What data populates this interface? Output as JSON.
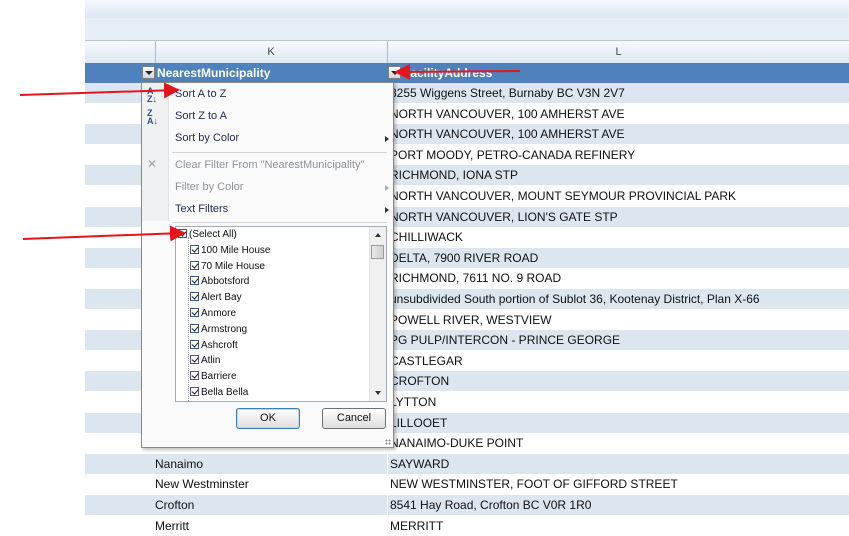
{
  "columns": {
    "k": "K",
    "l": "L"
  },
  "header": {
    "k_label": "NearestMunicipality",
    "l_label": "FacilityAddress"
  },
  "filter_menu": {
    "sort_az": "Sort A to Z",
    "sort_za": "Sort Z to A",
    "sort_by_color": "Sort by Color",
    "clear_filter": "Clear Filter From \"NearestMunicipality\"",
    "filter_by_color": "Filter by Color",
    "text_filters": "Text Filters",
    "list": [
      "(Select All)",
      "100 Mile House",
      "70 Mile House",
      "Abbotsford",
      "Alert Bay",
      "Anmore",
      "Armstrong",
      "Ashcroft",
      "Atlin",
      "Barriere",
      "Bella Bella"
    ],
    "ok": "OK",
    "cancel": "Cancel"
  },
  "rows": [
    {
      "k": "",
      "l": "8255 Wiggens Street, Burnaby BC  V3N 2V7"
    },
    {
      "k": "",
      "l": "NORTH VANCOUVER, 100 AMHERST AVE"
    },
    {
      "k": "",
      "l": "NORTH VANCOUVER, 100 AMHERST AVE"
    },
    {
      "k": "",
      "l": "PORT MOODY, PETRO-CANADA REFINERY"
    },
    {
      "k": "",
      "l": "RICHMOND, IONA STP"
    },
    {
      "k": "",
      "l": "NORTH VANCOUVER, MOUNT SEYMOUR PROVINCIAL PARK"
    },
    {
      "k": "",
      "l": "NORTH VANCOUVER, LION'S GATE STP"
    },
    {
      "k": "",
      "l": "CHILLIWACK"
    },
    {
      "k": "",
      "l": "DELTA, 7900 RIVER ROAD"
    },
    {
      "k": "",
      "l": "RICHMOND, 7611 NO. 9 ROAD"
    },
    {
      "k": "",
      "l": "unsubdivided South portion of Sublot 36, Kootenay District, Plan X-66"
    },
    {
      "k": "",
      "l": "POWELL RIVER, WESTVIEW"
    },
    {
      "k": "",
      "l": "PG PULP/INTERCON - PRINCE GEORGE"
    },
    {
      "k": "",
      "l": "CASTLEGAR"
    },
    {
      "k": "",
      "l": "CROFTON"
    },
    {
      "k": "",
      "l": "LYTTON"
    },
    {
      "k": "",
      "l": "LILLOOET"
    },
    {
      "k": "",
      "l": "NANAIMO-DUKE POINT"
    },
    {
      "k": "Nanaimo",
      "l": "SAYWARD"
    },
    {
      "k": "New Westminster",
      "l": "NEW WESTMINSTER, FOOT OF GIFFORD STREET"
    },
    {
      "k": "Crofton",
      "l": "8541 Hay Road, Crofton BC  V0R 1R0"
    },
    {
      "k": "Merritt",
      "l": "MERRITT"
    }
  ],
  "colors": {
    "header_blue": "#4f81bd",
    "band": "#dce6f1",
    "arrow_red": "#e8141b"
  }
}
